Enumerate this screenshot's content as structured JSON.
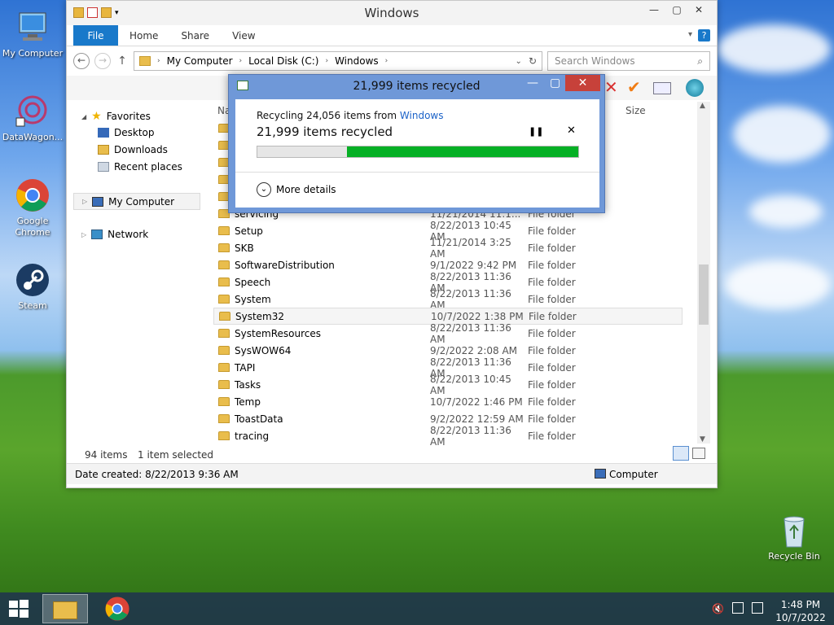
{
  "desktop": {
    "icons": [
      {
        "label": "My Computer"
      },
      {
        "label": "DataWagon..."
      },
      {
        "label": "Google Chrome"
      },
      {
        "label": "Steam"
      },
      {
        "label": "Recycle Bin"
      }
    ]
  },
  "explorer": {
    "title": "Windows",
    "ribbon_tabs": [
      "File",
      "Home",
      "Share",
      "View"
    ],
    "address": {
      "parts": [
        "My Computer",
        "Local Disk (C:)",
        "Windows"
      ]
    },
    "search_placeholder": "Search Windows",
    "columns": {
      "name": "Na",
      "size": "Size"
    },
    "nav": {
      "favorites": "Favorites",
      "desktop": "Desktop",
      "downloads": "Downloads",
      "recent": "Recent places",
      "my_computer": "My Computer",
      "network": "Network"
    },
    "rows": [
      {
        "name": "servicing",
        "date": "11/21/2014 11:1...",
        "type": "File folder"
      },
      {
        "name": "Setup",
        "date": "8/22/2013 10:45 AM",
        "type": "File folder"
      },
      {
        "name": "SKB",
        "date": "11/21/2014 3:25 AM",
        "type": "File folder"
      },
      {
        "name": "SoftwareDistribution",
        "date": "9/1/2022 9:42 PM",
        "type": "File folder"
      },
      {
        "name": "Speech",
        "date": "8/22/2013 11:36 AM",
        "type": "File folder"
      },
      {
        "name": "System",
        "date": "8/22/2013 11:36 AM",
        "type": "File folder"
      },
      {
        "name": "System32",
        "date": "10/7/2022 1:38 PM",
        "type": "File folder"
      },
      {
        "name": "SystemResources",
        "date": "8/22/2013 11:36 AM",
        "type": "File folder"
      },
      {
        "name": "SysWOW64",
        "date": "9/2/2022 2:08 AM",
        "type": "File folder"
      },
      {
        "name": "TAPI",
        "date": "8/22/2013 11:36 AM",
        "type": "File folder"
      },
      {
        "name": "Tasks",
        "date": "8/22/2013 10:45 AM",
        "type": "File folder"
      },
      {
        "name": "Temp",
        "date": "10/7/2022 1:46 PM",
        "type": "File folder"
      },
      {
        "name": "ToastData",
        "date": "9/2/2022 12:59 AM",
        "type": "File folder"
      },
      {
        "name": "tracing",
        "date": "8/22/2013 11:36 AM",
        "type": "File folder"
      }
    ],
    "selected_row": 6,
    "status": {
      "items": "94 items",
      "selected": "1 item selected"
    },
    "details": {
      "date_created": "Date created: 8/22/2013 9:36 AM",
      "location": "Computer"
    }
  },
  "dialog": {
    "title": "21,999 items recycled",
    "from_text": "Recycling 24,056 items from ",
    "from_link": "Windows",
    "headline": "21,999 items recycled",
    "progress_fraction": 0.72,
    "more_details": "More details",
    "colors": {
      "progress": "#06b025",
      "link": "#1b62c8"
    }
  },
  "taskbar": {
    "time": "1:48 PM",
    "date": "10/7/2022"
  }
}
